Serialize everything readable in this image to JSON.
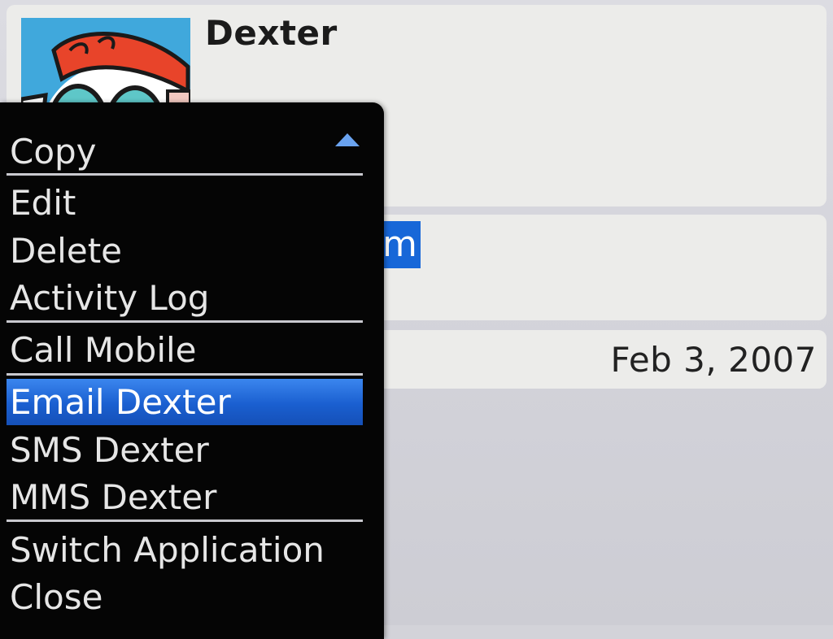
{
  "contact": {
    "name": "Dexter",
    "email_visible_fragment": "m",
    "date": "Feb 3, 2007"
  },
  "menu": {
    "items": [
      {
        "label": "Copy"
      },
      {
        "label": "Edit"
      },
      {
        "label": "Delete"
      },
      {
        "label": "Activity Log"
      },
      {
        "label": "Call Mobile"
      },
      {
        "label": "Email Dexter",
        "selected": true
      },
      {
        "label": "SMS Dexter"
      },
      {
        "label": "MMS Dexter"
      },
      {
        "label": "Switch Application"
      },
      {
        "label": "Close"
      }
    ]
  },
  "colors": {
    "menu_background": "#050505",
    "selection": "#1a5fd0",
    "panel": "#ececea"
  },
  "icons": {
    "scroll": "scroll-up-icon"
  }
}
